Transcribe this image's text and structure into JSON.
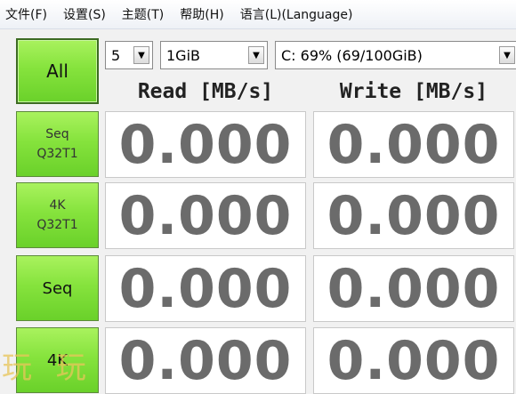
{
  "menu": [
    "文件(F)",
    "设置(S)",
    "主题(T)",
    "帮助(H)",
    "语言(L)(Language)"
  ],
  "buttons": {
    "all": "All",
    "seq_q32t1": [
      "Seq",
      "Q32T1"
    ],
    "k4_q32t1": [
      "4K",
      "Q32T1"
    ],
    "seq": "Seq",
    "k4": "4K"
  },
  "controls": {
    "count": "5",
    "size": "1GiB",
    "drive": "C: 69% (69/100GiB)"
  },
  "headers": {
    "read": "Read [MB/s]",
    "write": "Write [MB/s]"
  },
  "results": [
    {
      "read": "0.000",
      "write": "0.000"
    },
    {
      "read": "0.000",
      "write": "0.000"
    },
    {
      "read": "0.000",
      "write": "0.000"
    },
    {
      "read": "0.000",
      "write": "0.000"
    }
  ],
  "watermark": "玩 玩"
}
